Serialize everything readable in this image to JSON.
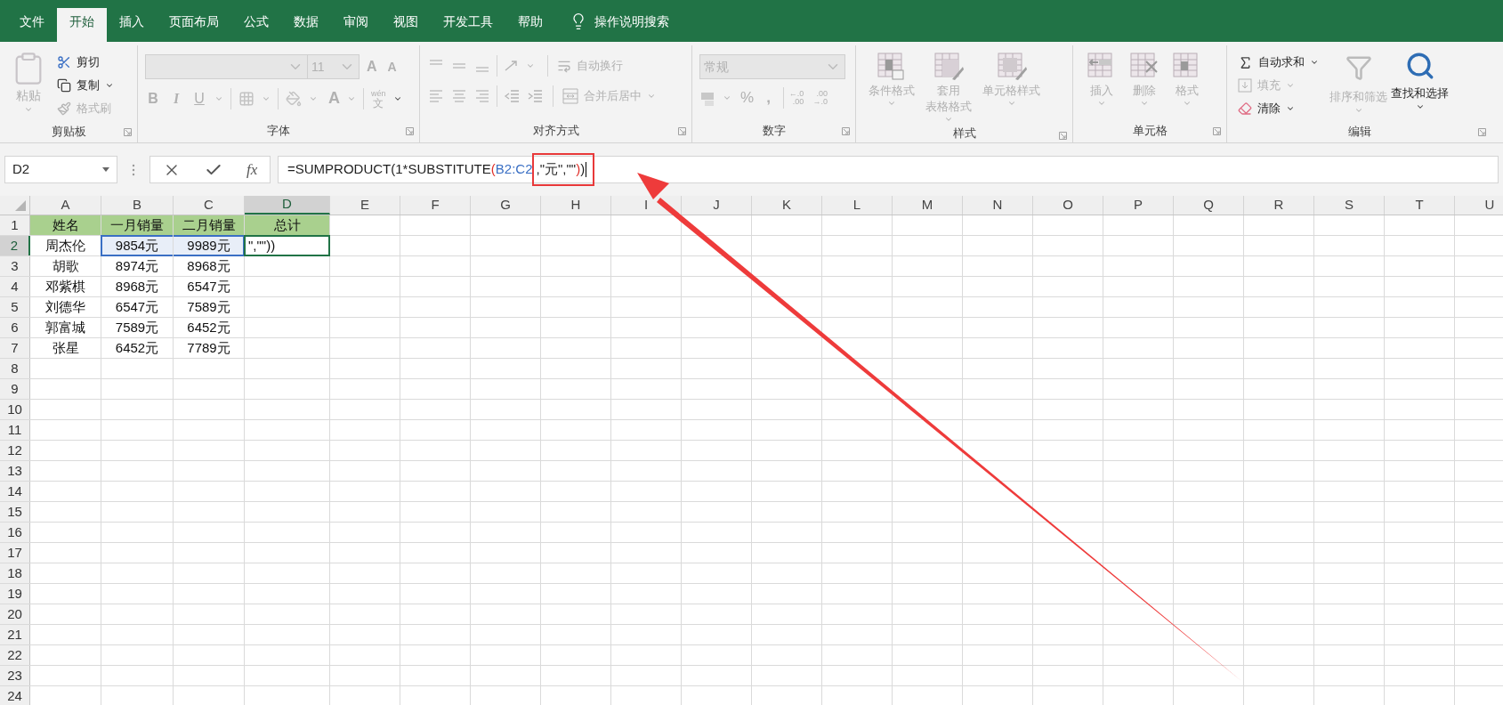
{
  "tabs": [
    {
      "label": "文件",
      "selected": false
    },
    {
      "label": "开始",
      "selected": true
    },
    {
      "label": "插入",
      "selected": false
    },
    {
      "label": "页面布局",
      "selected": false
    },
    {
      "label": "公式",
      "selected": false
    },
    {
      "label": "数据",
      "selected": false
    },
    {
      "label": "审阅",
      "selected": false
    },
    {
      "label": "视图",
      "selected": false
    },
    {
      "label": "开发工具",
      "selected": false
    },
    {
      "label": "帮助",
      "selected": false
    }
  ],
  "tell_me": {
    "placeholder": "操作说明搜索"
  },
  "ribbon": {
    "clipboard": {
      "label": "剪贴板",
      "paste": {
        "label": "粘贴",
        "disabled": true
      },
      "cut": {
        "label": "剪切",
        "disabled": false
      },
      "copy": {
        "label": "复制",
        "disabled": false
      },
      "format_painter": {
        "label": "格式刷",
        "disabled": true
      }
    },
    "font": {
      "label": "字体",
      "font_size": "11",
      "grow": "A",
      "shrink": "A",
      "bold": "B",
      "italic": "I",
      "underline": "U",
      "font_color": "A",
      "phonetic": {
        "top": "wén",
        "bottom": "文"
      }
    },
    "alignment": {
      "label": "对齐方式",
      "wrap_text": {
        "label": "自动换行",
        "disabled": true
      },
      "merge": {
        "label": "合并后居中",
        "disabled": true
      }
    },
    "number": {
      "label": "数字",
      "format": "常规",
      "percent": "%",
      "comma": ",",
      "decrease_decimal": {
        "top": "←.0",
        "bottom": ".00"
      },
      "increase_decimal": {
        "top": ".00",
        "bottom": "→.0"
      }
    },
    "styles": {
      "label": "样式",
      "items": [
        {
          "lines": [
            "条件格式"
          ],
          "disabled": true
        },
        {
          "lines": [
            "套用",
            "表格格式"
          ],
          "disabled": true
        },
        {
          "lines": [
            "单元格样式"
          ],
          "disabled": true
        }
      ]
    },
    "cells": {
      "label": "单元格",
      "items": [
        {
          "lines": [
            "插入"
          ],
          "disabled": true
        },
        {
          "lines": [
            "删除"
          ],
          "disabled": true
        },
        {
          "lines": [
            "格式"
          ],
          "disabled": true
        }
      ]
    },
    "editing": {
      "label": "编辑",
      "autosum": {
        "label": "自动求和",
        "disabled": false
      },
      "fill": {
        "label": "填充",
        "disabled": true
      },
      "clear": {
        "label": "清除",
        "disabled": false
      },
      "sort_filter": {
        "label": "排序和筛选",
        "disabled": true
      },
      "find_select": {
        "label": "查找和选择",
        "disabled": false
      }
    }
  },
  "formula_bar": {
    "name_box": "D2",
    "function_label": "fx",
    "segments": [
      {
        "text": "=SUMPRODUCT(1*SUBSTITUTE",
        "color": "#1f1f1f",
        "highlighted": false
      },
      {
        "text": "(",
        "color": "#e0302a",
        "highlighted": false
      },
      {
        "text": "B2:C2",
        "color": "#3a6fc4",
        "highlighted": false
      },
      {
        "text": ",\"元\",\"\"",
        "color": "#1f1f1f",
        "highlighted": true
      },
      {
        "text": ")",
        "color": "#e0302a",
        "highlighted": true
      },
      {
        "text": ")",
        "color": "#1f1f1f",
        "highlighted": true
      }
    ]
  },
  "sheet": {
    "columns": [
      {
        "label": "A",
        "selected": false
      },
      {
        "label": "B",
        "selected": false
      },
      {
        "label": "C",
        "selected": false
      },
      {
        "label": "D",
        "selected": true
      },
      {
        "label": "E",
        "selected": false
      },
      {
        "label": "F",
        "selected": false
      },
      {
        "label": "G",
        "selected": false
      },
      {
        "label": "H",
        "selected": false
      },
      {
        "label": "I",
        "selected": false
      },
      {
        "label": "J",
        "selected": false
      },
      {
        "label": "K",
        "selected": false
      },
      {
        "label": "L",
        "selected": false
      },
      {
        "label": "M",
        "selected": false
      },
      {
        "label": "N",
        "selected": false
      },
      {
        "label": "O",
        "selected": false
      },
      {
        "label": "P",
        "selected": false
      },
      {
        "label": "Q",
        "selected": false
      },
      {
        "label": "R",
        "selected": false
      },
      {
        "label": "S",
        "selected": false
      },
      {
        "label": "T",
        "selected": false
      },
      {
        "label": "U",
        "selected": false
      }
    ],
    "rows": [
      {
        "header": "1",
        "selected": false,
        "cells": [
          {
            "text": "姓名",
            "kind": "header"
          },
          {
            "text": "一月销量",
            "kind": "header"
          },
          {
            "text": "二月销量",
            "kind": "header"
          },
          {
            "text": "总计",
            "kind": "header"
          }
        ]
      },
      {
        "header": "2",
        "selected": true,
        "cells": [
          {
            "text": "周杰伦",
            "kind": "plain"
          },
          {
            "text": "9854元",
            "kind": "reference"
          },
          {
            "text": "9989元",
            "kind": "reference"
          },
          {
            "text": "\",\"\"))",
            "kind": "active"
          }
        ]
      },
      {
        "header": "3",
        "selected": false,
        "cells": [
          {
            "text": "胡歌",
            "kind": "plain"
          },
          {
            "text": "8974元",
            "kind": "plain"
          },
          {
            "text": "8968元",
            "kind": "plain"
          }
        ]
      },
      {
        "header": "4",
        "selected": false,
        "cells": [
          {
            "text": "邓紫棋",
            "kind": "plain"
          },
          {
            "text": "8968元",
            "kind": "plain"
          },
          {
            "text": "6547元",
            "kind": "plain"
          }
        ]
      },
      {
        "header": "5",
        "selected": false,
        "cells": [
          {
            "text": "刘德华",
            "kind": "plain"
          },
          {
            "text": "6547元",
            "kind": "plain"
          },
          {
            "text": "7589元",
            "kind": "plain"
          }
        ]
      },
      {
        "header": "6",
        "selected": false,
        "cells": [
          {
            "text": "郭富城",
            "kind": "plain"
          },
          {
            "text": "7589元",
            "kind": "plain"
          },
          {
            "text": "6452元",
            "kind": "plain"
          }
        ]
      },
      {
        "header": "7",
        "selected": false,
        "cells": [
          {
            "text": "张星",
            "kind": "plain"
          },
          {
            "text": "6452元",
            "kind": "plain"
          },
          {
            "text": "7789元",
            "kind": "plain"
          }
        ]
      },
      {
        "header": "8",
        "selected": false
      },
      {
        "header": "9",
        "selected": false
      },
      {
        "header": "10",
        "selected": false
      },
      {
        "header": "11",
        "selected": false
      },
      {
        "header": "12",
        "selected": false
      },
      {
        "header": "13",
        "selected": false
      },
      {
        "header": "14",
        "selected": false
      },
      {
        "header": "15",
        "selected": false
      },
      {
        "header": "16",
        "selected": false
      },
      {
        "header": "17",
        "selected": false
      },
      {
        "header": "18",
        "selected": false
      },
      {
        "header": "19",
        "selected": false
      },
      {
        "header": "20",
        "selected": false
      },
      {
        "header": "21",
        "selected": false
      },
      {
        "header": "22",
        "selected": false
      },
      {
        "header": "23",
        "selected": false
      },
      {
        "header": "24",
        "selected": false
      }
    ]
  }
}
